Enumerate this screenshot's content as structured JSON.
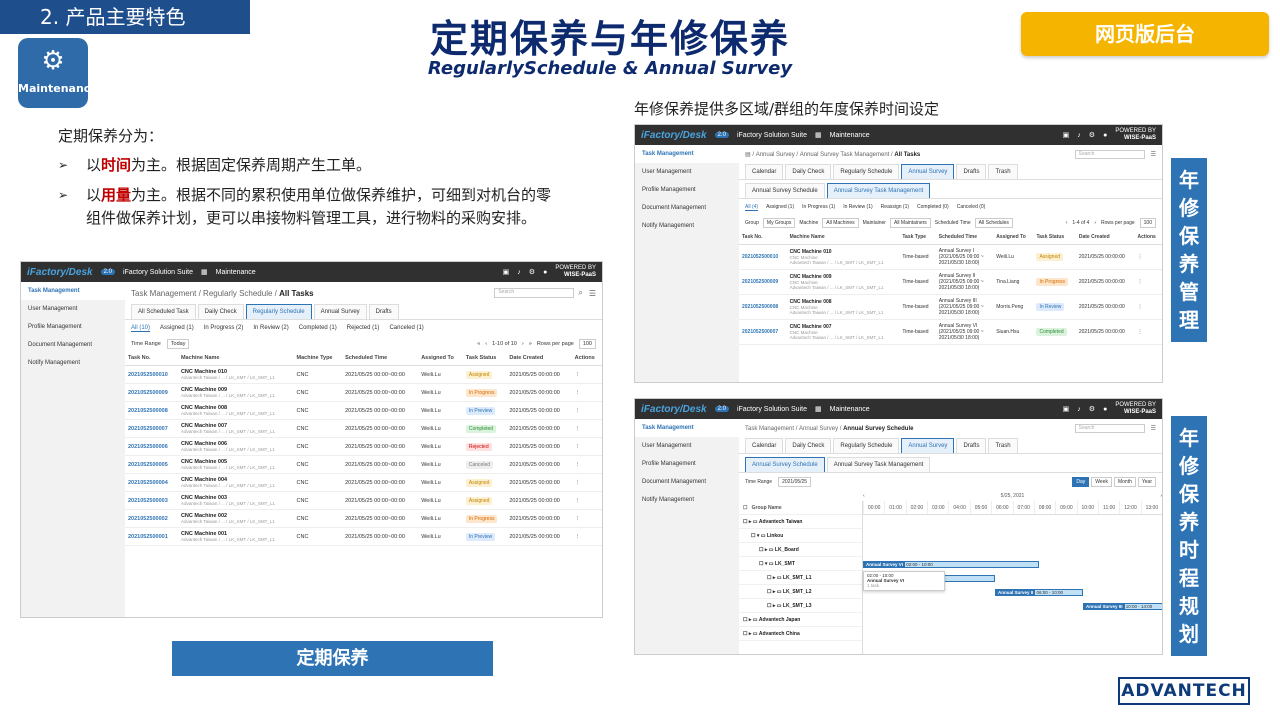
{
  "section": "2. 产品主要特色",
  "logo": {
    "text": "Maintenance"
  },
  "title": "定期保养与年修保养",
  "subtitle": "RegularlySchedule & Annual Survey",
  "web_button": "网页版后台",
  "annual_caption": "年修保养提供多区域/群组的年度保养时间设定",
  "intro": "定期保养分为：",
  "bullets": [
    {
      "pre": "以",
      "hl": "时间",
      "post": "为主。根据固定保养周期产生工单。"
    },
    {
      "pre": "以",
      "hl": "用量",
      "post": "为主。根据不同的累积使用单位做保养维护，可细到对机台的零组件做保养计划，更可以串接物料管理工具，进行物料的采购安排。"
    }
  ],
  "bottom_button": "定期保养",
  "vtag1": "年修保养管理",
  "vtag2": "年修保养时程规划",
  "adv_logo": "ADVANTECH",
  "app": {
    "brand": "iFactory/Desk",
    "version": "2.0",
    "suite": "iFactory Solution Suite",
    "module": "Maintenance",
    "powered": "POWERED BY",
    "wise": "WISE-PaaS",
    "side": [
      "Task Management",
      "User Management",
      "Profile Management",
      "Document Management",
      "Notify Management"
    ],
    "search": "Search"
  },
  "s1": {
    "crumb1": "Task Management",
    "crumb2": "Regularly Schedule",
    "crumb3": "All Tasks",
    "tabs": [
      "All Scheduled Task",
      "Daily Check",
      "Regularly Schedule",
      "Annual Survey",
      "Drafts"
    ],
    "subtabs": [
      "All (10)",
      "Assigned (1)",
      "In Progress (2)",
      "In Review (2)",
      "Completed (1)",
      "Rejected (1)",
      "Canceled (1)"
    ],
    "timerange": "Time Range",
    "today": "Today",
    "pager": "1-10 of 10",
    "rpp": "Rows per page",
    "rppv": "100",
    "cols": [
      "Task No.",
      "Machine Name",
      "Machine Type",
      "Scheduled Time",
      "Assigned To",
      "Task Status",
      "Date Created",
      "Actions"
    ],
    "rows": [
      {
        "no": "2021052500010",
        "name": "CNC Machine 010",
        "sub": "Advantech Taiwan / ... / LK_SMT / LK_SMT_L1",
        "type": "CNC",
        "time": "2021/05/25 00:00~00:00",
        "to": "Weili.Lu",
        "status": "Assigned",
        "cls": "b-assigned",
        "date": "2021/05/25 00:00:00"
      },
      {
        "no": "2021052500009",
        "name": "CNC Machine 009",
        "sub": "Advantech Taiwan / ... / LK_SMT / LK_SMT_L1",
        "type": "CNC",
        "time": "2021/05/25 00:00~00:00",
        "to": "Weili.Lu",
        "status": "In Progress",
        "cls": "b-inprogress",
        "date": "2021/05/25 00:00:00"
      },
      {
        "no": "2021052500008",
        "name": "CNC Machine 008",
        "sub": "Advantech Taiwan / ... / LK_SMT / LK_SMT_L1",
        "type": "CNC",
        "time": "2021/05/25 00:00~00:00",
        "to": "Weili.Lu",
        "status": "In Preview",
        "cls": "b-inpreview",
        "date": "2021/05/25 00:00:00"
      },
      {
        "no": "2021052500007",
        "name": "CNC Machine 007",
        "sub": "Advantech Taiwan / ... / LK_SMT / LK_SMT_L1",
        "type": "CNC",
        "time": "2021/05/25 00:00~00:00",
        "to": "Weili.Lu",
        "status": "Completed",
        "cls": "b-completed",
        "date": "2021/05/25 00:00:00"
      },
      {
        "no": "2021052500006",
        "name": "CNC Machine 006",
        "sub": "Advantech Taiwan / ... / LK_SMT / LK_SMT_L1",
        "type": "CNC",
        "time": "2021/05/25 00:00~00:00",
        "to": "Weili.Lu",
        "status": "Rejected",
        "cls": "b-rejected",
        "date": "2021/05/25 00:00:00"
      },
      {
        "no": "2021052500005",
        "name": "CNC Machine 005",
        "sub": "Advantech Taiwan / ... / LK_SMT / LK_SMT_L1",
        "type": "CNC",
        "time": "2021/05/25 00:00~00:00",
        "to": "Weili.Lu",
        "status": "Canceled",
        "cls": "b-canceled",
        "date": "2021/05/25 00:00:00"
      },
      {
        "no": "2021052500004",
        "name": "CNC Machine 004",
        "sub": "Advantech Taiwan / ... / LK_SMT / LK_SMT_L1",
        "type": "CNC",
        "time": "2021/05/25 00:00~00:00",
        "to": "Weili.Lu",
        "status": "Assigned",
        "cls": "b-assigned",
        "date": "2021/05/25 00:00:00"
      },
      {
        "no": "2021052500003",
        "name": "CNC Machine 003",
        "sub": "Advantech Taiwan / ... / LK_SMT / LK_SMT_L1",
        "type": "CNC",
        "time": "2021/05/25 00:00~00:00",
        "to": "Weili.Lu",
        "status": "Assigned",
        "cls": "b-assigned",
        "date": "2021/05/25 00:00:00"
      },
      {
        "no": "2021052500002",
        "name": "CNC Machine 002",
        "sub": "Advantech Taiwan / ... / LK_SMT / LK_SMT_L1",
        "type": "CNC",
        "time": "2021/05/25 00:00~00:00",
        "to": "Weili.Lu",
        "status": "In Progress",
        "cls": "b-inprogress",
        "date": "2021/05/25 00:00:00"
      },
      {
        "no": "2021052500001",
        "name": "CNC Machine 001",
        "sub": "Advantech Taiwan / ... / LK_SMT / LK_SMT_L1",
        "type": "CNC",
        "time": "2021/05/25 00:00~00:00",
        "to": "Weili.Lu",
        "status": "In Preview",
        "cls": "b-inpreview",
        "date": "2021/05/25 00:00:00"
      }
    ]
  },
  "s2": {
    "crumb1": "Annual Survey",
    "crumb2": "Annual Survey Task Management",
    "crumb3": "All Tasks",
    "tabs": [
      "Calendar",
      "Daily Check",
      "Regularly Schedule",
      "Annual Survey",
      "Drafts",
      "Trash"
    ],
    "subtabs": [
      "Annual Survey Schedule",
      "Annual Survey Task Management"
    ],
    "filters": [
      "All (4)",
      "Assigned (1)",
      "In Progress (1)",
      "In Review (1)",
      "Reassign (1)",
      "Completed (0)",
      "Canceled (0)"
    ],
    "group": "Group",
    "groupv": "My Groups",
    "machine": "Machine",
    "machinev": "All Machines",
    "maint": "Maintainer",
    "maintv": "All Maintainers",
    "st": "Scheduled Time",
    "stv": "All Schedules",
    "pager": "1-4 of 4",
    "rpp": "Rows per page",
    "rppv": "100",
    "cols": [
      "Task No.",
      "Machine Name",
      "Task Type",
      "Scheduled Time",
      "Assigned To",
      "Task Status",
      "Date Created",
      "Actions"
    ],
    "rows": [
      {
        "no": "2021052500010",
        "name": "CNC Machine 010",
        "sub": "CNC Machine",
        "sub2": "Advantech Taiwan / ... / LK_SMT / LK_SMT_L1",
        "type": "Time-based",
        "time": "Annual Survey I",
        "t2": "(2021/05/25 09:00 ~",
        "t3": "2021/05/30 18:00)",
        "to": "Weili.Lu",
        "status": "Assigned",
        "cls": "b-assigned",
        "date": "2021/05/25 00:00:00"
      },
      {
        "no": "2021052500009",
        "name": "CNC Machine 009",
        "sub": "CNC Machine",
        "sub2": "Advantech Taiwan / ... / LK_SMT / LK_SMT_L1",
        "type": "Time-based",
        "time": "Annual Survey II",
        "t2": "(2021/05/25 09:00 ~",
        "t3": "2021/05/30 18:00)",
        "to": "Tina.Liang",
        "status": "In Progress",
        "cls": "b-inprogress",
        "date": "2021/05/25 00:00:00"
      },
      {
        "no": "2021052500008",
        "name": "CNC Machine 008",
        "sub": "CNC Machine",
        "sub2": "Advantech Taiwan / ... / LK_SMT / LK_SMT_L1",
        "type": "Time-based",
        "time": "Annual Survey III",
        "t2": "(2021/05/25 09:00 ~",
        "t3": "2021/05/30 18:00)",
        "to": "Morris.Peng",
        "status": "In Review",
        "cls": "b-inreview",
        "date": "2021/05/25 00:00:00"
      },
      {
        "no": "2021052500007",
        "name": "CNC Machine 007",
        "sub": "CNC Machine",
        "sub2": "Advantech Taiwan / ... / LK_SMT / LK_SMT_L1",
        "type": "Time-based",
        "time": "Annual Survey VI",
        "t2": "(2021/05/25 09:00 ~",
        "t3": "2021/05/30 18:00)",
        "to": "Siuan.Hsu",
        "status": "Completed",
        "cls": "b-completed",
        "date": "2021/05/25 00:00:00"
      }
    ]
  },
  "s3": {
    "crumb1": "Task Management",
    "crumb2": "Annual Survey",
    "crumb3": "Annual Survey Schedule",
    "tabs": [
      "Calendar",
      "Daily Check",
      "Regularly Schedule",
      "Annual Survey",
      "Drafts",
      "Trash"
    ],
    "subtabs": [
      "Annual Survey Schedule",
      "Annual Survey Task Management"
    ],
    "timerange": "Time Range",
    "trv": "2021/05/25",
    "views": [
      "Day",
      "Week",
      "Month",
      "Year"
    ],
    "date": "5/25, 2021",
    "grp": "Group Name",
    "hours": [
      "00:00",
      "01:00",
      "02:00",
      "03:00",
      "04:00",
      "05:00",
      "06:00",
      "07:00",
      "08:00",
      "09:00",
      "10:00",
      "11:00",
      "12:00",
      "13:00"
    ],
    "tree": [
      "Advantech Taiwan",
      "Linkou",
      "LK_Board",
      "LK_SMT",
      "LK_SMT_L1",
      "LK_SMT_L2",
      "LK_SMT_L3",
      "Advantech Japan",
      "Advantech China"
    ],
    "bars": [
      {
        "label": "Annual Survey VI",
        "time": "02:00 - 10:00"
      },
      {
        "label": "",
        "time": "02:00 - 06:00"
      },
      {
        "label": "Annual Survey II",
        "time": "06:00 - 10:00"
      },
      {
        "label": "Annual Survey III",
        "time": "10:00 - 14:00"
      }
    ],
    "popup": {
      "time": "02:00 - 10:00",
      "title": "Annual Survey VI",
      "sub": "1 task"
    }
  }
}
